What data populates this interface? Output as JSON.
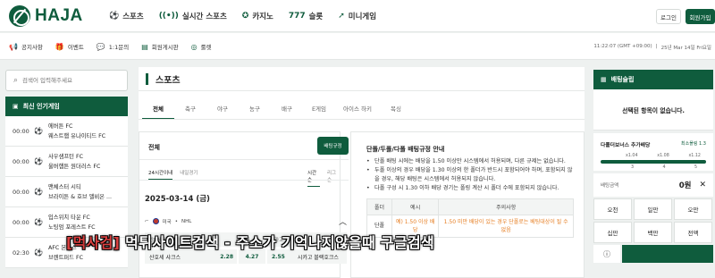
{
  "brand": {
    "name": "HAJA"
  },
  "nav": [
    {
      "label": "스포츠",
      "icon": "soccer-ball-icon"
    },
    {
      "label": "실시간 스포츠",
      "icon": "live-signal-icon"
    },
    {
      "label": "카지노",
      "icon": "casino-chip-icon"
    },
    {
      "label": "슬롯",
      "icon": "slot-777-icon"
    },
    {
      "label": "미니게임",
      "icon": "rocket-icon"
    }
  ],
  "auth": {
    "login": "로그인",
    "join": "회원가입"
  },
  "subnav": [
    {
      "label": "공지사항",
      "icon": "megaphone-icon"
    },
    {
      "label": "이벤트",
      "icon": "gift-icon"
    },
    {
      "label": "1:1문의",
      "icon": "chat-icon"
    },
    {
      "label": "회원게시판",
      "icon": "board-icon"
    },
    {
      "label": "룰렛",
      "icon": "roulette-icon"
    }
  ],
  "clock": {
    "time": "11:22:07 (GMT +09:00)",
    "sep": "|",
    "date": "25년 Mar 14일 Fri요일"
  },
  "search": {
    "placeholder": "검색어 입력해주세요"
  },
  "popular": {
    "title": "최신 인기게임",
    "matches": [
      {
        "time": "00:00",
        "home": "에버튼 FC",
        "away": "웨스트햄 유나이티드 FC"
      },
      {
        "time": "00:00",
        "home": "사우샘프턴 FC",
        "away": "울버햄튼 원더러스 FC"
      },
      {
        "time": "00:00",
        "home": "맨체스터 시티",
        "away": "브라이튼 & 호브 앨비온 ..."
      },
      {
        "time": "00:00",
        "home": "입스위치 타운 FC",
        "away": "노팅엄 포레스트 FC"
      },
      {
        "time": "02:30",
        "home": "AFC 본머스",
        "away": "브렌트퍼드 FC"
      }
    ]
  },
  "main": {
    "title": "스포츠",
    "tabs": [
      "전체",
      "축구",
      "야구",
      "농구",
      "배구",
      "E게임",
      "아이스 하키",
      "복싱"
    ],
    "panel_title": "전체",
    "rule_button": "배팅규정",
    "time_tabs": [
      "24시간이내",
      "내일경기"
    ],
    "sort_tabs": [
      "시간순",
      "리그순"
    ],
    "date": "2025-03-14 (금)",
    "league": {
      "country": "미국",
      "sep": "•",
      "name": "NHL"
    },
    "col_home": "선호세 샤크스",
    "col_mid": "무",
    "col_away": "시카고 블랙호크스",
    "odds": {
      "home_team": "산호세 샤크스",
      "home": "2.28",
      "draw": "4.27",
      "away": "2.55",
      "away_team": "시카고 블랙호크스"
    }
  },
  "rules": {
    "title": "단폴/두폴/다폴 배팅규정 안내",
    "items": [
      "단폴 배팅 시에는 배당을 1.50 이상만 시스템에서 허용되며, 다른 규제는 없습니다.",
      "두폴 이상의 경우 배당을 1.30 이상의 한 폴더가 반드시 포함되어야 하며, 포함되지 않을 경우, 해당 배팅은 시스템에서 허용되지 않습니다.",
      "다폴 구성 시 1.30 이하 배당 경기는 폴링 계산 시 폴더 수에 포함되지 않습니다."
    ],
    "table": {
      "headers": [
        "폴더",
        "예시",
        "주의사항"
      ],
      "row": {
        "fold": "단폴",
        "example": "예) 1.50 이상 배당",
        "note": "1.50 미만 배당이 있는 경우 단폴로는 베팅대상이 될 수 없음"
      }
    }
  },
  "slip": {
    "title": "배팅슬립",
    "empty": "선택된 항목이 없습니다.",
    "bonus_title": "다폴더보너스 추가배당",
    "bonus_min": "최소폴링 1.3",
    "bonus_marks": [
      "3",
      "4",
      "5"
    ],
    "bonus_vals": [
      "x1.04",
      "x1.08",
      "x1.12"
    ],
    "amount_label": "배팅금액",
    "amount": "0원",
    "chips": [
      "오천",
      "일만",
      "오만",
      "십만",
      "백만",
      "전액"
    ]
  },
  "watermark": {
    "tag": "[먹사검]",
    "text": " 먹튀사이트검색 - 주소가 기억나지않을때 구글검색"
  },
  "colors": {
    "brand": "#0f5c3d",
    "warn": "#e67e22"
  }
}
